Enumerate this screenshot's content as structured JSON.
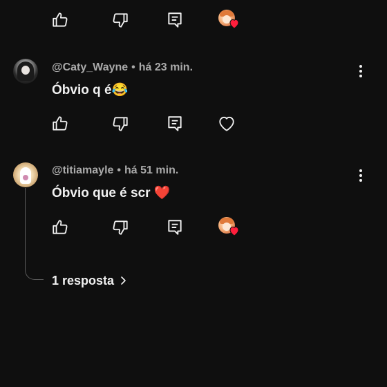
{
  "top_actions": {
    "like_icon": "thumb-up-icon",
    "dislike_icon": "thumb-down-icon",
    "reply_icon": "reply-comment-icon",
    "creator_heart": "creator-heart-badge"
  },
  "comments": [
    {
      "author": "@Caty_Wayne",
      "time": "há 23 min.",
      "text": "Óbvio q é😂",
      "actions": {
        "like_icon": "thumb-up-icon",
        "dislike_icon": "thumb-down-icon",
        "reply_icon": "reply-comment-icon",
        "heart_icon": "heart-outline-icon"
      }
    },
    {
      "author": "@titiamayle",
      "time": "há 51 min.",
      "text": "Óbvio que é scr ❤️",
      "actions": {
        "like_icon": "thumb-up-icon",
        "dislike_icon": "thumb-down-icon",
        "reply_icon": "reply-comment-icon",
        "creator_heart": "creator-heart-badge"
      },
      "replies_label": "1 resposta"
    }
  ],
  "separator": "•",
  "colors": {
    "background": "#0f0f0f",
    "text": "#f1f1f1",
    "meta": "#aaaaaa",
    "heart": "#ff1e3c"
  }
}
